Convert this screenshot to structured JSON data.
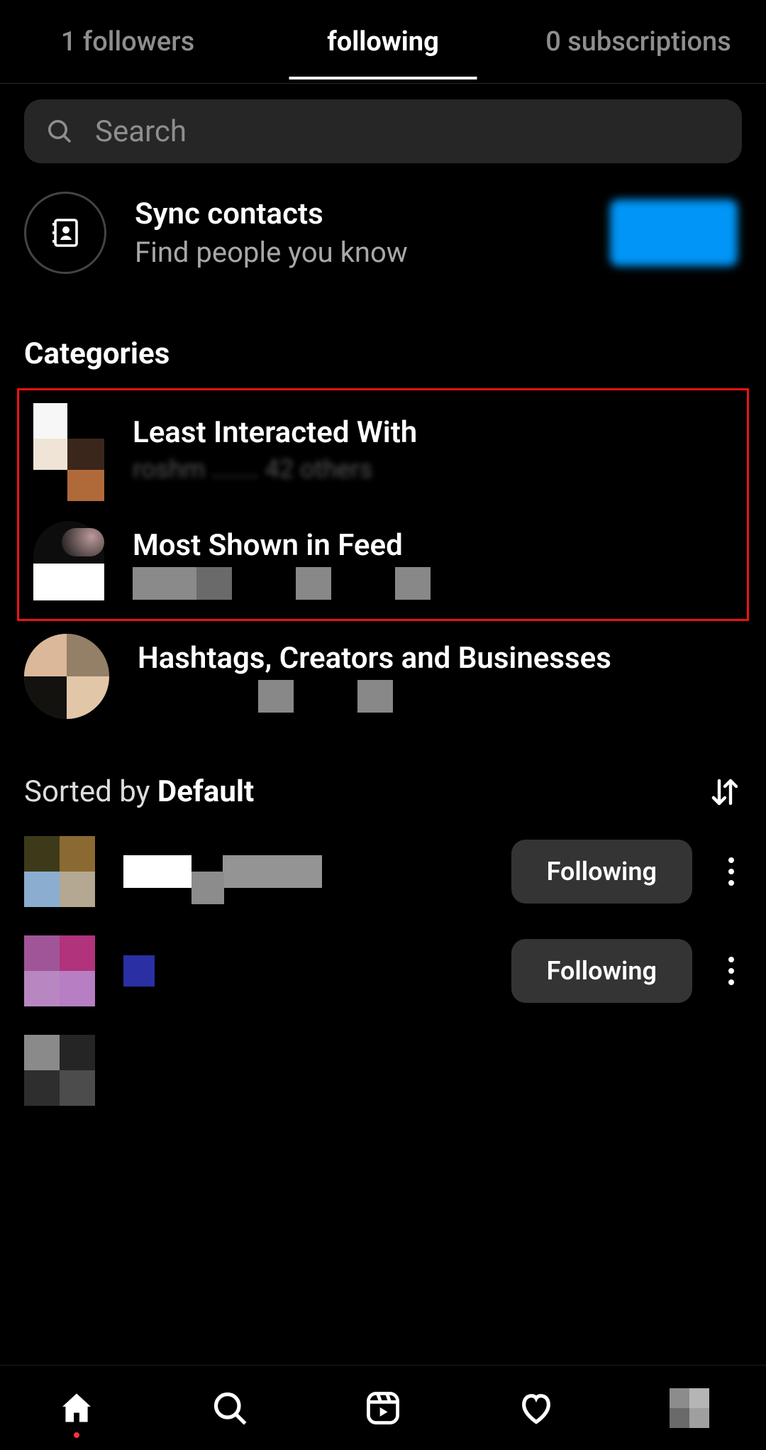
{
  "tabs": {
    "followers": "1 followers",
    "following": "following",
    "subscriptions": "0 subscriptions"
  },
  "search": {
    "placeholder": "Search"
  },
  "sync": {
    "title": "Sync contacts",
    "subtitle": "Find people you know"
  },
  "categories": {
    "header": "Categories",
    "least": {
      "title": "Least Interacted With"
    },
    "most": {
      "title": "Most Shown in Feed"
    },
    "hashtags": {
      "title": "Hashtags, Creators and Businesses"
    }
  },
  "sort": {
    "prefix": "Sorted by ",
    "value": "Default"
  },
  "list": {
    "follow_label": "Following"
  }
}
